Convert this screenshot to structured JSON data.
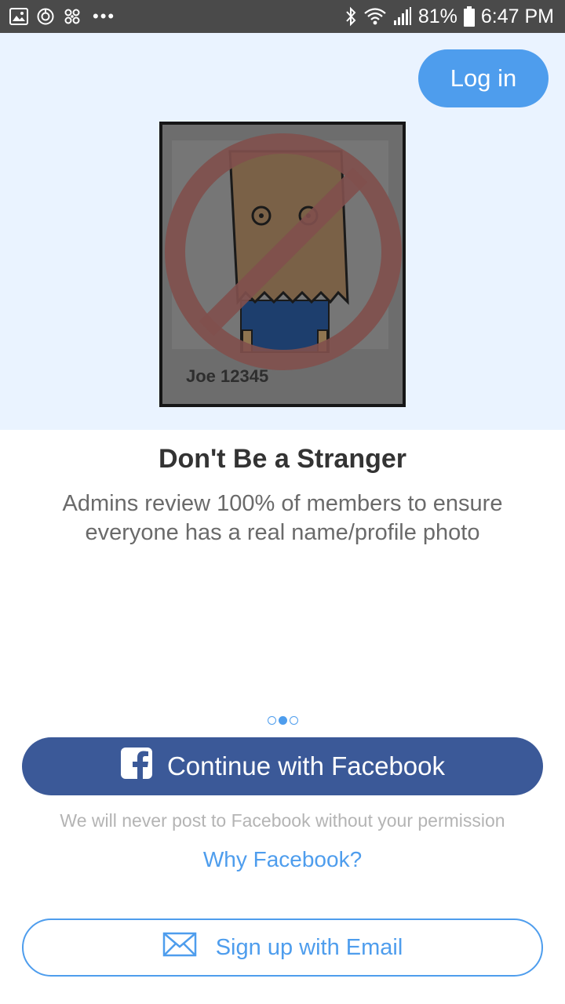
{
  "status_bar": {
    "battery": "81%",
    "time": "6:47 PM",
    "dots": "•••",
    "left_icons": [
      "gallery-icon",
      "sync-icon",
      "pinwheel-icon"
    ],
    "right_icons": [
      "bluetooth-icon",
      "wifi-icon",
      "signal-icon",
      "battery-icon"
    ]
  },
  "header": {
    "login_label": "Log in"
  },
  "illustration": {
    "caption": "Joe 12345"
  },
  "content": {
    "title": "Don't Be a Stranger",
    "subtitle": "Admins review 100% of members to ensure everyone has a real name/profile photo"
  },
  "pager": {
    "count": 3,
    "active_index": 1
  },
  "facebook": {
    "button_label": "Continue with Facebook",
    "note": "We will never post to Facebook without your permission",
    "why_label": "Why Facebook?"
  },
  "email": {
    "button_label": "Sign up with Email"
  },
  "colors": {
    "accent": "#4e9ded",
    "facebook": "#3b5998",
    "hero_bg": "#eaf3ff",
    "status_bar": "#4a4a4a"
  }
}
